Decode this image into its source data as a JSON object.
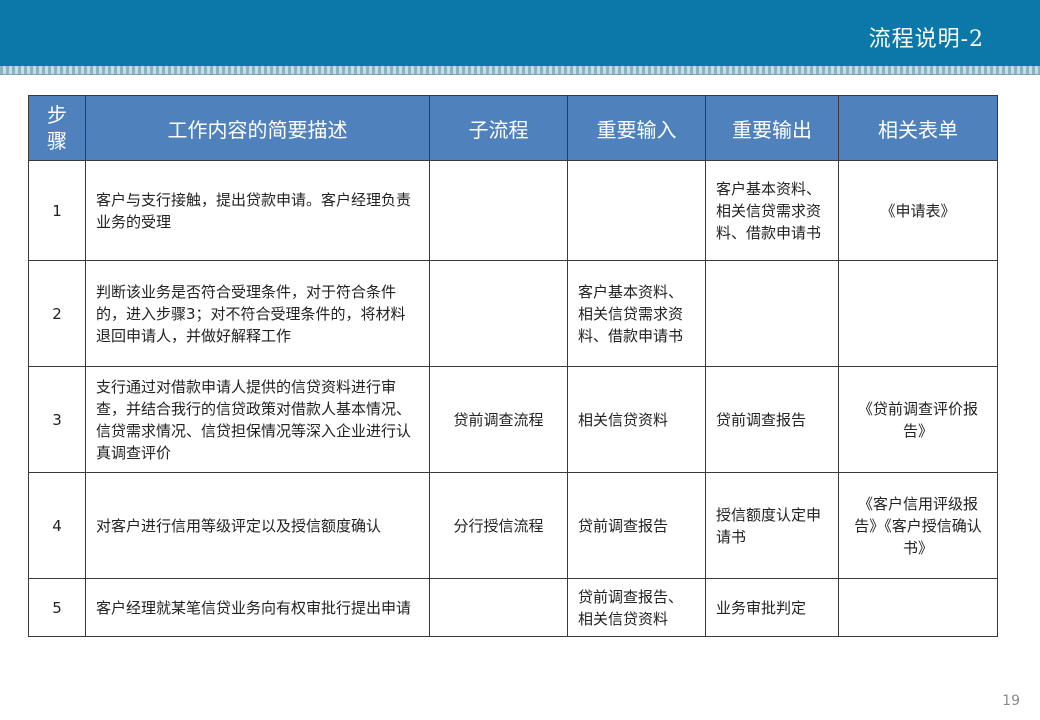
{
  "header": {
    "title": "流程说明-2"
  },
  "table": {
    "headers": {
      "step": "步骤",
      "desc": "工作内容的简要描述",
      "subprocess": "子流程",
      "input": "重要输入",
      "output": "重要输出",
      "forms": "相关表单"
    },
    "rows": [
      {
        "step": "1",
        "desc": "客户与支行接触，提出贷款申请。客户经理负责业务的受理",
        "subprocess": "",
        "input": "",
        "output": "客户基本资料、相关信贷需求资料、借款申请书",
        "forms": "《申请表》"
      },
      {
        "step": "2",
        "desc": "判断该业务是否符合受理条件，对于符合条件的，进入步骤3；对不符合受理条件的，将材料退回申请人，并做好解释工作",
        "subprocess": "",
        "input": "客户基本资料、相关信贷需求资料、借款申请书",
        "output": "",
        "forms": ""
      },
      {
        "step": "3",
        "desc": "支行通过对借款申请人提供的信贷资料进行审查，并结合我行的信贷政策对借款人基本情况、信贷需求情况、信贷担保情况等深入企业进行认真调查评价",
        "subprocess": "贷前调查流程",
        "input": "相关信贷资料",
        "output": "贷前调查报告",
        "forms": "《贷前调查评价报告》"
      },
      {
        "step": "4",
        "desc": "对客户进行信用等级评定以及授信额度确认",
        "subprocess": "分行授信流程",
        "input": "贷前调查报告",
        "output": "授信额度认定申请书",
        "forms": "《客户信用评级报告》《客户授信确认书》"
      },
      {
        "step": "5",
        "desc": "客户经理就某笔信贷业务向有权审批行提出申请",
        "subprocess": "",
        "input": "贷前调查报告、相关信贷资料",
        "output": "业务审批判定",
        "forms": ""
      }
    ]
  },
  "footer": {
    "page_number": "19"
  }
}
